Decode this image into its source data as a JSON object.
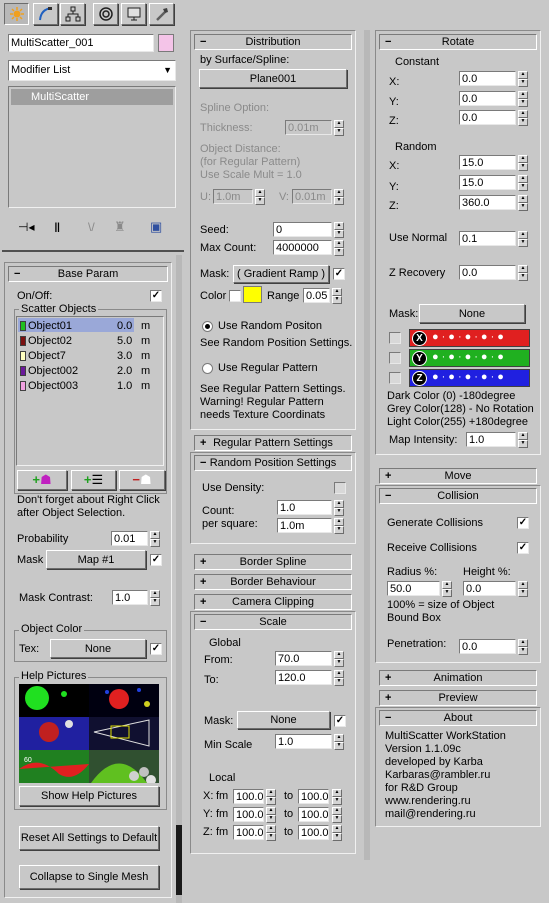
{
  "top_tabs": [
    {
      "name": "create-tab-icon"
    },
    {
      "name": "modify-tab-icon"
    },
    {
      "name": "hierarchy-tab-icon"
    },
    {
      "name": "motion-tab-icon"
    },
    {
      "name": "display-tab-icon"
    },
    {
      "name": "utilities-tab-icon"
    }
  ],
  "object_name": "MultiScatter_001",
  "object_color": "#f4c4e8",
  "modifier_list": "Modifier List",
  "modifier_stack": [
    "MultiScatter"
  ],
  "base": {
    "title": "Base Param",
    "onoff": "On/Off:",
    "scatter_objects": "Scatter Objects",
    "objects": [
      {
        "name": "Object01",
        "value": "0.0",
        "unit": "m",
        "color": "#20c020"
      },
      {
        "name": "Object02",
        "value": "5.0",
        "unit": "m",
        "color": "#7a1010"
      },
      {
        "name": "Object7",
        "value": "3.0",
        "unit": "m",
        "color": "#ffffc0"
      },
      {
        "name": "Object002",
        "value": "2.0",
        "unit": "m",
        "color": "#6a1a9a"
      },
      {
        "name": "Object003",
        "value": "1.0",
        "unit": "m",
        "color": "#f0a0e0"
      }
    ],
    "note1": "Don't forget about Right Click",
    "note2": "after Object Selection.",
    "probability_label": "Probability",
    "probability": "0.01",
    "mask_label": "Mask",
    "mask_button": "Map #1",
    "mask_contrast_label": "Mask Contrast:",
    "mask_contrast": "1.0",
    "object_color_title": "Object Color",
    "tex_label": "Tex:",
    "tex_button": "None",
    "help_title": "Help Pictures",
    "show_help": "Show Help Pictures",
    "reset": "Reset All Settings to Default",
    "collapse": "Collapse to Single Mesh"
  },
  "dist": {
    "title": "Distribution",
    "by_surface": "by Surface/Spline:",
    "surface_button": "Plane001",
    "spline_option": "Spline Option:",
    "thickness_label": "Thickness:",
    "thickness": "0.01m",
    "objdist1": "Object Distance:",
    "objdist2": "(for Regular Pattern)",
    "objdist3": "Use Scale Mult = 1.0",
    "u_label": "U:",
    "u": "1.0m",
    "v_label": "V:",
    "v": "0.01m",
    "seed_label": "Seed:",
    "seed": "0",
    "maxcount_label": "Max Count:",
    "maxcount": "4000000",
    "mask_label": "Mask:",
    "mask_button": "( Gradient Ramp )",
    "color_label": "Color",
    "swatch": "#ffff00",
    "range_label": "Range",
    "range": "0.05",
    "use_random": "Use Random Positon",
    "see_random": "See Random Position Settings.",
    "use_regular": "Use Regular Pattern",
    "see_regular1": "See Regular Pattern Settings.",
    "see_regular2": "Warning! Regular Pattern",
    "see_regular3": "needs Texture Coordinats"
  },
  "regular_title": "Regular Pattern Settings",
  "randpos": {
    "title": "Random Position Settings",
    "use_density": "Use Density:",
    "count1": "Count:",
    "count2": "per square:",
    "count": "1.0",
    "per_square": "1.0m"
  },
  "border_spline": "Border Spline",
  "border_behaviour": "Border Behaviour",
  "camera_clipping": "Camera Clipping",
  "scale": {
    "title": "Scale",
    "global": "Global",
    "from_label": "From:",
    "from": "70.0",
    "to_label": "To:",
    "to": "120.0",
    "mask_label": "Mask:",
    "mask_button": "None",
    "minscale_label": "Min Scale",
    "minscale": "1.0",
    "local": "Local",
    "fm": "fm",
    "to_small": "to",
    "rows": [
      {
        "axis": "X:",
        "from": "100.0",
        "to": "100.0"
      },
      {
        "axis": "Y:",
        "from": "100.0",
        "to": "100.0"
      },
      {
        "axis": "Z:",
        "from": "100.0",
        "to": "100.0"
      }
    ]
  },
  "rotate": {
    "title": "Rotate",
    "constant": "Constant",
    "cx_label": "X:",
    "cx": "0.0",
    "cy_label": "Y:",
    "cy": "0.0",
    "cz_label": "Z:",
    "cz": "0.0",
    "random": "Random",
    "rx_label": "X:",
    "rx": "15.0",
    "ry_label": "Y:",
    "ry": "15.0",
    "rz_label": "Z:",
    "rz": "360.0",
    "use_normal_label": "Use Normal",
    "use_normal": "0.1",
    "z_recovery_label": "Z Recovery",
    "z_recovery": "0.0",
    "mask_label": "Mask:",
    "mask_button": "None",
    "axes": [
      {
        "label": "X",
        "color": "#e02020"
      },
      {
        "label": "Y",
        "color": "#20b020"
      },
      {
        "label": "Z",
        "color": "#2020e0"
      }
    ],
    "dark": "Dark Color (0)    -180degree",
    "grey": "Grey Color(128) - No Rotation",
    "light": "Light Color(255)  +180degree",
    "map_intensity_label": "Map Intensity:",
    "map_intensity": "1.0"
  },
  "move_title": "Move",
  "collision": {
    "title": "Collision",
    "generate": "Generate Collisions",
    "receive": "Receive Collisions",
    "radius_label": "Radius %:",
    "height_label": "Height %:",
    "radius": "50.0",
    "height": "0.0",
    "note1": "100% = size of Object",
    "note2": "Bound  Box",
    "penetration_label": "Penetration:",
    "penetration": "0.0"
  },
  "animation_title": "Animation",
  "preview_title": "Preview",
  "about": {
    "title": "About",
    "lines": [
      "MultiScatter WorkStation",
      "Version 1.1.09c",
      "developed by Karba",
      "Karbaras@rambler.ru",
      "for R&D Group",
      "www.rendering.ru",
      "mail@rendering.ru"
    ]
  }
}
